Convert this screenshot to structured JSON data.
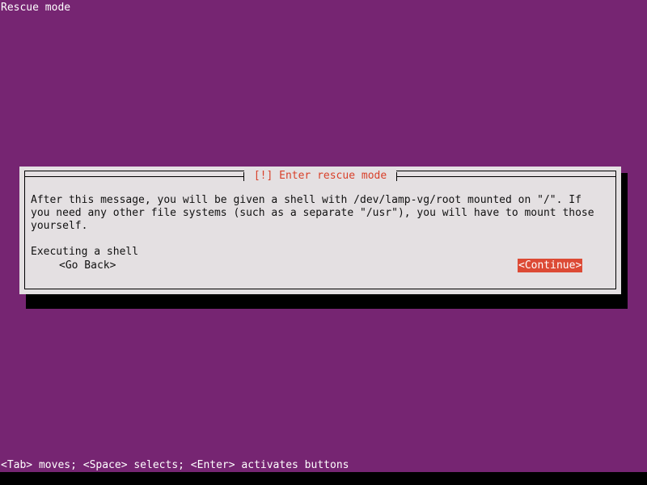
{
  "screen": {
    "background_color": "#762572",
    "foreground_color": "#ffffff",
    "top_title": "Rescue mode"
  },
  "dialog": {
    "title": "[!] Enter rescue mode",
    "title_color": "#d8402a",
    "background_color": "#e4e0e2",
    "border_color": "#000000",
    "text_color": "#111111",
    "body_lines": [
      "After this message, you will be given a shell with /dev/lamp-vg/root mounted on \"/\". If",
      "you need any other file systems (such as a separate \"/usr\"), you will have to mount those",
      "yourself."
    ],
    "status_line": "Executing a shell",
    "buttons": [
      {
        "id": "go-back",
        "label": "<Go Back>",
        "selected": false,
        "background_color": "transparent",
        "text_color": "#111111"
      },
      {
        "id": "continue",
        "label": "<Continue>",
        "selected": true,
        "background_color": "#dc4a35",
        "text_color": "#ffffff"
      }
    ]
  },
  "footer": {
    "help_text": "<Tab> moves; <Space> selects; <Enter> activates buttons"
  }
}
